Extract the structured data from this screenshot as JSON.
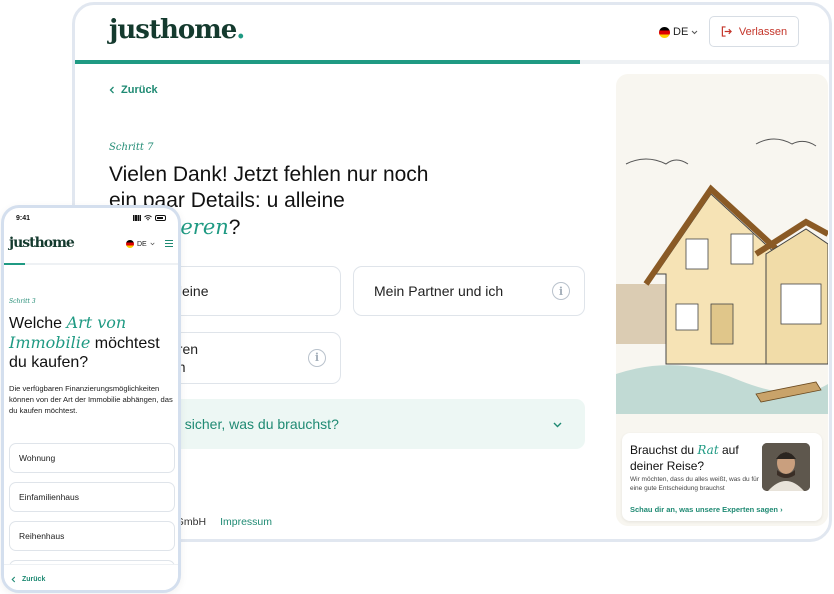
{
  "tablet": {
    "logo": "justhome",
    "logo_dot": ".",
    "language": "DE",
    "exit_label": "Verlassen",
    "progress": 0.67,
    "back_label": "Zurück",
    "step_label": "Schritt 7",
    "title_before": "Vielen Dank! Jetzt fehlen nur noch ein paar Details: ",
    "title_visible_rest": "u alleine ",
    "title_accent": "finanzieren",
    "title_after": "?",
    "options": [
      {
        "label": "alleine"
      },
      {
        "label": "Mein Partner und ich"
      },
      {
        "label_line1": "eren",
        "label_line2": "en"
      }
    ],
    "accordion_label": "t sicher, was du brauchst?",
    "footer_company": "e GmbH",
    "footer_link": "Impressum"
  },
  "advisor": {
    "title_before": "Brauchst du ",
    "title_accent": "Rat",
    "title_after": " auf deiner Reise?",
    "text": "Wir möchten, dass du alles weißt, was du für eine gute Entscheidung brauchst",
    "link": "Schau dir an, was unsere Experten sagen"
  },
  "phone": {
    "time": "9:41",
    "logo": "justhome",
    "language": "DE",
    "progress": 0.12,
    "step_label": "Schritt 3",
    "title_before": "Welche ",
    "title_accent": "Art von Immobilie",
    "title_after": " möchtest du kaufen?",
    "description": "Die verfügbaren Finanzierungsmöglichkeiten können von der Art der Immobilie abhängen, das du kaufen möchtest.",
    "options": [
      "Wohnung",
      "Einfamilienhaus",
      "Reihenhaus"
    ],
    "back_label": "Zurück"
  },
  "colors": {
    "accent": "#1f9a83",
    "brand_dark": "#143a2e",
    "exit_red": "#c4352a",
    "accordion_bg": "#edf7f4"
  }
}
